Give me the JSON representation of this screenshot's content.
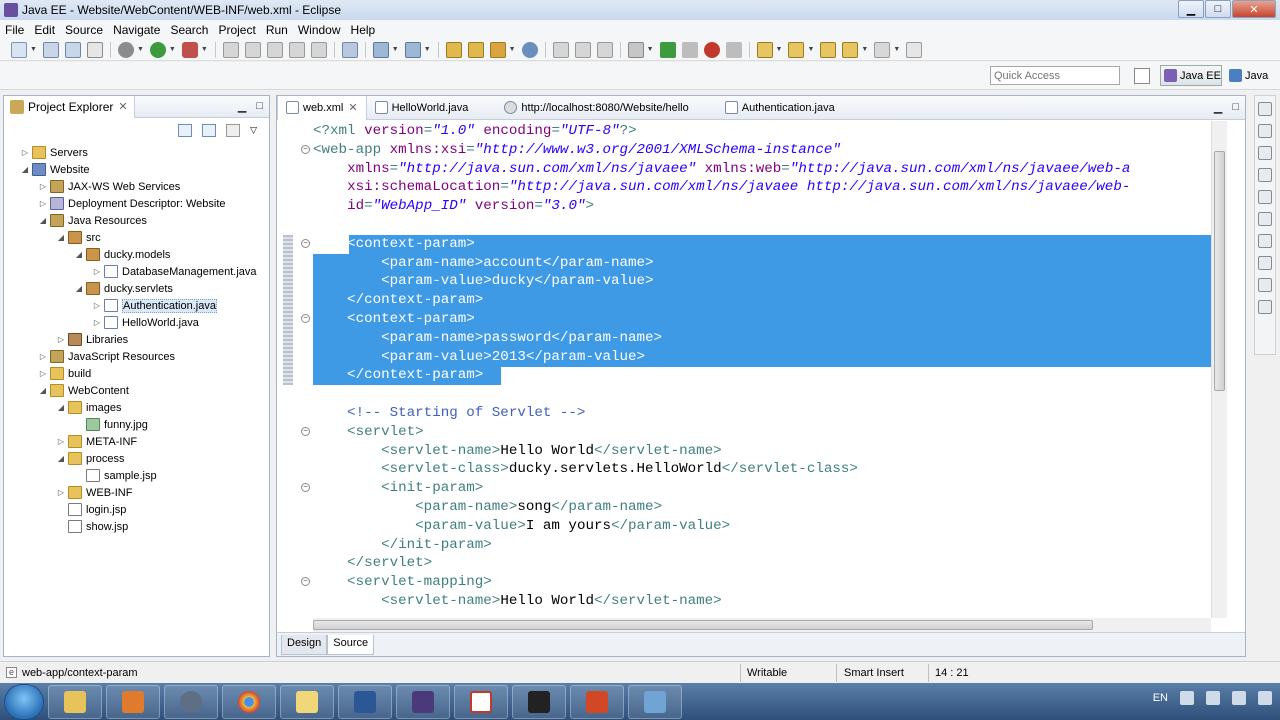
{
  "window": {
    "title": "Java EE - Website/WebContent/WEB-INF/web.xml - Eclipse",
    "min": "▁",
    "max": "□",
    "close": "✕"
  },
  "menu": [
    "File",
    "Edit",
    "Source",
    "Navigate",
    "Search",
    "Project",
    "Run",
    "Window",
    "Help"
  ],
  "perspective": {
    "quick_access_placeholder": "Quick Access",
    "active": "Java EE",
    "other": "Java"
  },
  "explorer": {
    "tab_label": "Project Explorer",
    "tab_close": "✕",
    "tree": [
      {
        "label": "Servers",
        "twisty": "▷",
        "icon": "folder",
        "indent": 0
      },
      {
        "label": "Website",
        "twisty": "◢",
        "icon": "project",
        "indent": 0
      },
      {
        "label": "JAX-WS Web Services",
        "twisty": "▷",
        "icon": "svc",
        "indent": 1
      },
      {
        "label": "Deployment Descriptor: Website",
        "twisty": "▷",
        "icon": "desc",
        "indent": 1
      },
      {
        "label": "Java Resources",
        "twisty": "◢",
        "icon": "svc",
        "indent": 1
      },
      {
        "label": "src",
        "twisty": "◢",
        "icon": "pkg",
        "indent": 2
      },
      {
        "label": "ducky.models",
        "twisty": "◢",
        "icon": "pkg",
        "indent": 3
      },
      {
        "label": "DatabaseManagement.java",
        "twisty": "▷",
        "icon": "java",
        "indent": 4
      },
      {
        "label": "ducky.servlets",
        "twisty": "◢",
        "icon": "pkg",
        "indent": 3
      },
      {
        "label": "Authentication.java",
        "twisty": "▷",
        "icon": "java",
        "indent": 4,
        "selected": true
      },
      {
        "label": "HelloWorld.java",
        "twisty": "▷",
        "icon": "java",
        "indent": 4
      },
      {
        "label": "Libraries",
        "twisty": "▷",
        "icon": "lib",
        "indent": 2
      },
      {
        "label": "JavaScript Resources",
        "twisty": "▷",
        "icon": "svc",
        "indent": 1
      },
      {
        "label": "build",
        "twisty": "▷",
        "icon": "folder",
        "indent": 1
      },
      {
        "label": "WebContent",
        "twisty": "◢",
        "icon": "folder",
        "indent": 1
      },
      {
        "label": "images",
        "twisty": "◢",
        "icon": "folder",
        "indent": 2
      },
      {
        "label": "funny.jpg",
        "twisty": "",
        "icon": "img",
        "indent": 3
      },
      {
        "label": "META-INF",
        "twisty": "▷",
        "icon": "folder",
        "indent": 2
      },
      {
        "label": "process",
        "twisty": "◢",
        "icon": "folder",
        "indent": 2
      },
      {
        "label": "sample.jsp",
        "twisty": "",
        "icon": "jsp",
        "indent": 3
      },
      {
        "label": "WEB-INF",
        "twisty": "▷",
        "icon": "folder",
        "indent": 2
      },
      {
        "label": "login.jsp",
        "twisty": "",
        "icon": "jsp",
        "indent": 2
      },
      {
        "label": "show.jsp",
        "twisty": "",
        "icon": "jsp",
        "indent": 2
      }
    ]
  },
  "editor": {
    "tabs": [
      {
        "label": "web.xml",
        "active": true,
        "close": "✕",
        "icon": "xml"
      },
      {
        "label": "HelloWorld.java",
        "active": false,
        "icon": "java"
      },
      {
        "label": "http://localhost:8080/Website/hello",
        "active": false,
        "icon": "web"
      },
      {
        "label": "Authentication.java",
        "active": false,
        "icon": "java"
      }
    ],
    "lines": [
      {
        "fold": false,
        "selected": false,
        "parts": [
          [
            "tag",
            "<?"
          ],
          [
            "tag",
            "xml "
          ],
          [
            "attr",
            "version"
          ],
          [
            "tag",
            "="
          ],
          [
            "str",
            "\"1.0\""
          ],
          [
            "tag",
            " "
          ],
          [
            "attr",
            "encoding"
          ],
          [
            "tag",
            "="
          ],
          [
            "str",
            "\"UTF-8\""
          ],
          [
            "tag",
            "?>"
          ]
        ]
      },
      {
        "fold": true,
        "selected": false,
        "parts": [
          [
            "tag",
            "<web-app "
          ],
          [
            "attr",
            "xmlns:xsi"
          ],
          [
            "tag",
            "="
          ],
          [
            "str",
            "\"http://www.w3.org/2001/XMLSchema-instance\""
          ]
        ]
      },
      {
        "fold": false,
        "selected": false,
        "parts": [
          [
            "tag",
            "    "
          ],
          [
            "attr",
            "xmlns"
          ],
          [
            "tag",
            "="
          ],
          [
            "str",
            "\"http://java.sun.com/xml/ns/javaee\""
          ],
          [
            "tag",
            " "
          ],
          [
            "attr",
            "xmlns:web"
          ],
          [
            "tag",
            "="
          ],
          [
            "str",
            "\"http://java.sun.com/xml/ns/javaee/web-a"
          ]
        ]
      },
      {
        "fold": false,
        "selected": false,
        "parts": [
          [
            "tag",
            "    "
          ],
          [
            "attr",
            "xsi:schemaLocation"
          ],
          [
            "tag",
            "="
          ],
          [
            "str",
            "\"http://java.sun.com/xml/ns/javaee http://java.sun.com/xml/ns/javaee/web-"
          ]
        ]
      },
      {
        "fold": false,
        "selected": false,
        "parts": [
          [
            "tag",
            "    "
          ],
          [
            "attr",
            "id"
          ],
          [
            "tag",
            "="
          ],
          [
            "str",
            "\"WebApp_ID\""
          ],
          [
            "tag",
            " "
          ],
          [
            "attr",
            "version"
          ],
          [
            "tag",
            "="
          ],
          [
            "str",
            "\"3.0\""
          ],
          [
            "tag",
            ">"
          ]
        ]
      },
      {
        "fold": false,
        "selected": false,
        "parts": []
      },
      {
        "fold": true,
        "selected": "partial",
        "parts": [
          [
            "sel",
            "    <context-param>"
          ]
        ]
      },
      {
        "fold": false,
        "selected": true,
        "parts": [
          [
            "sel",
            "        <param-name>account</param-name>"
          ]
        ]
      },
      {
        "fold": false,
        "selected": true,
        "parts": [
          [
            "sel",
            "        <param-value>ducky</param-value>"
          ]
        ]
      },
      {
        "fold": false,
        "selected": true,
        "parts": [
          [
            "sel",
            "    </context-param>"
          ]
        ]
      },
      {
        "fold": true,
        "selected": true,
        "parts": [
          [
            "sel",
            "    <context-param>"
          ]
        ]
      },
      {
        "fold": false,
        "selected": true,
        "parts": [
          [
            "sel",
            "        <param-name>password</param-name>"
          ]
        ]
      },
      {
        "fold": false,
        "selected": true,
        "parts": [
          [
            "sel",
            "        <param-value>2013</param-value>"
          ]
        ]
      },
      {
        "fold": false,
        "selected": "end",
        "parts": [
          [
            "sel",
            "    </context-param>"
          ]
        ]
      },
      {
        "fold": false,
        "selected": false,
        "parts": []
      },
      {
        "fold": false,
        "selected": false,
        "parts": [
          [
            "com",
            "    <!-- Starting of Servlet -->"
          ]
        ]
      },
      {
        "fold": true,
        "selected": false,
        "parts": [
          [
            "tag",
            "    <servlet>"
          ]
        ]
      },
      {
        "fold": false,
        "selected": false,
        "parts": [
          [
            "tag",
            "        <servlet-name>"
          ],
          [
            "txt",
            "Hello World"
          ],
          [
            "tag",
            "</servlet-name>"
          ]
        ]
      },
      {
        "fold": false,
        "selected": false,
        "parts": [
          [
            "tag",
            "        <servlet-class>"
          ],
          [
            "txt",
            "ducky.servlets.HelloWorld"
          ],
          [
            "tag",
            "</servlet-class>"
          ]
        ]
      },
      {
        "fold": true,
        "selected": false,
        "parts": [
          [
            "tag",
            "        <init-param>"
          ]
        ]
      },
      {
        "fold": false,
        "selected": false,
        "parts": [
          [
            "tag",
            "            <param-name>"
          ],
          [
            "txt",
            "song"
          ],
          [
            "tag",
            "</param-name>"
          ]
        ]
      },
      {
        "fold": false,
        "selected": false,
        "parts": [
          [
            "tag",
            "            <param-value>"
          ],
          [
            "txt",
            "I am yours"
          ],
          [
            "tag",
            "</param-value>"
          ]
        ]
      },
      {
        "fold": false,
        "selected": false,
        "parts": [
          [
            "tag",
            "        </init-param>"
          ]
        ]
      },
      {
        "fold": false,
        "selected": false,
        "parts": [
          [
            "tag",
            "    </servlet>"
          ]
        ]
      },
      {
        "fold": true,
        "selected": false,
        "parts": [
          [
            "tag",
            "    <servlet-mapping>"
          ]
        ]
      },
      {
        "fold": false,
        "selected": false,
        "parts": [
          [
            "tag",
            "        <servlet-name>"
          ],
          [
            "txt",
            "Hello World"
          ],
          [
            "tag",
            "</servlet-name>"
          ]
        ]
      }
    ],
    "bottom_tabs": [
      {
        "label": "Design",
        "active": false
      },
      {
        "label": "Source",
        "active": true
      }
    ]
  },
  "status": {
    "path": "web-app/context-param",
    "writable": "Writable",
    "insert_mode": "Smart Insert",
    "position": "14 : 21"
  },
  "taskbar": {
    "language": "EN"
  }
}
